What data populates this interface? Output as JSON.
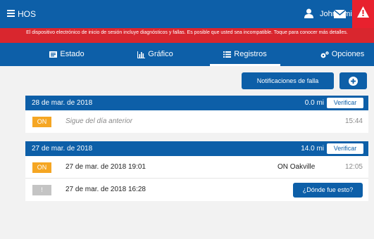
{
  "header": {
    "app_title": "HOS",
    "user_name": "John Smith"
  },
  "banner": {
    "text": "El dispositivo electrónico de inicio de sesión incluye diagnósticos y fallas. Es posible que usted sea incompatible. Toque para conocer más detalles."
  },
  "tabs": [
    {
      "label": "Estado",
      "icon": "status-icon"
    },
    {
      "label": "Gráfico",
      "icon": "bar-chart-icon"
    },
    {
      "label": "Registros",
      "icon": "list-icon",
      "active": true
    },
    {
      "label": "Opciones",
      "icon": "gears-icon"
    }
  ],
  "actions": {
    "fault_notifications_label": "Notificaciones de falla"
  },
  "days": [
    {
      "date": "28 de mar. de 2018",
      "distance": "0.0 mi",
      "verify_label": "Verificar",
      "entries": [
        {
          "status": "ON",
          "text": "Sigue del día anterior",
          "location": "",
          "time": "15:44"
        }
      ]
    },
    {
      "date": "27 de mar. de 2018",
      "distance": "14.0 mi",
      "verify_label": "Verificar",
      "entries": [
        {
          "status": "ON",
          "text": "27 de mar. de 2018 19:01",
          "location": "ON Oakville",
          "time": "12:05"
        },
        {
          "status": "!",
          "text": "27 de mar. de 2018 16:28",
          "button_label": "¿Dónde fue esto?"
        }
      ]
    }
  ],
  "colors": {
    "primary": "#0d5fa8",
    "alert": "#e8212e",
    "banner": "#d9262e",
    "on_status": "#f5a623",
    "unknown_status": "#c4c4c4"
  }
}
